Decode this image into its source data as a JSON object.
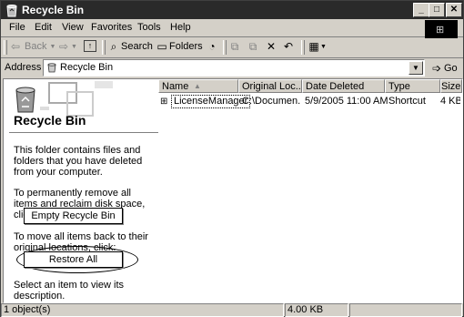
{
  "window": {
    "title": "Recycle Bin"
  },
  "menu": [
    "File",
    "Edit",
    "View",
    "Favorites",
    "Tools",
    "Help"
  ],
  "toolbar": {
    "back": "Back",
    "search": "Search",
    "folders": "Folders"
  },
  "address": {
    "label": "Address",
    "value": "Recycle Bin",
    "go": "Go"
  },
  "left_pane": {
    "heading": "Recycle Bin",
    "description": "This folder contains files and folders that you have deleted from your computer.",
    "empty_instruction": "To permanently remove all items and reclaim disk space, click:",
    "empty_button": "Empty Recycle Bin",
    "restore_instruction": "To move all items back to their original locations, click:",
    "restore_button": "Restore All",
    "select_hint": "Select an item to view its description."
  },
  "list": {
    "columns": [
      "Name",
      "Original Loc...",
      "Date Deleted",
      "Type",
      "Size"
    ],
    "rows": [
      {
        "name": "LicenseManager",
        "location": "C:\\Documen...",
        "date": "5/9/2005 11:00 AM",
        "type": "Shortcut",
        "size": "4 KB"
      }
    ]
  },
  "status": {
    "objects": "1 object(s)",
    "size": "4.00 KB"
  }
}
